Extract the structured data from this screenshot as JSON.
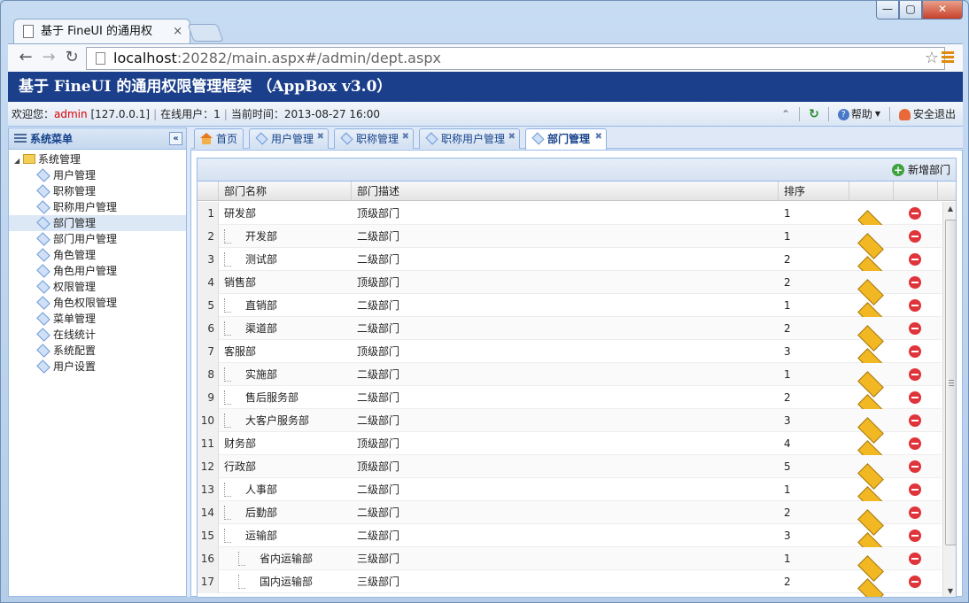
{
  "browser": {
    "tab_title": "基于 FineUI 的通用权",
    "url_host": "localhost",
    "url_rest": ":20282/main.aspx#/admin/dept.aspx",
    "window_buttons": [
      "—",
      "▢",
      "✕"
    ]
  },
  "app": {
    "title": "基于 FineUI 的通用权限管理框架 （AppBox v3.0）",
    "welcome_label": "欢迎您：",
    "user": "admin",
    "ip": "[127.0.0.1]",
    "online_label": "在线用户：",
    "online_count": "1",
    "time_label": "当前时间：",
    "time_value": "2013-08-27 16:00",
    "help": "帮助",
    "logout": "安全退出"
  },
  "sidebar": {
    "title": "系统菜单",
    "root": "系统管理",
    "items": [
      {
        "label": "用户管理"
      },
      {
        "label": "职称管理"
      },
      {
        "label": "职称用户管理"
      },
      {
        "label": "部门管理"
      },
      {
        "label": "部门用户管理"
      },
      {
        "label": "角色管理"
      },
      {
        "label": "角色用户管理"
      },
      {
        "label": "权限管理"
      },
      {
        "label": "角色权限管理"
      },
      {
        "label": "菜单管理"
      },
      {
        "label": "在线统计"
      },
      {
        "label": "系统配置"
      },
      {
        "label": "用户设置"
      }
    ]
  },
  "tabs": [
    {
      "label": "首页"
    },
    {
      "label": "用户管理"
    },
    {
      "label": "职称管理"
    },
    {
      "label": "职称用户管理"
    },
    {
      "label": "部门管理"
    }
  ],
  "grid": {
    "add_label": "新增部门",
    "columns": [
      "部门名称",
      "部门描述",
      "排序"
    ],
    "rows": [
      {
        "n": "1",
        "name": "研发部",
        "level": 0,
        "desc": "顶级部门",
        "sort": "1"
      },
      {
        "n": "2",
        "name": "开发部",
        "level": 1,
        "desc": "二级部门",
        "sort": "1"
      },
      {
        "n": "3",
        "name": "测试部",
        "level": 1,
        "desc": "二级部门",
        "sort": "2"
      },
      {
        "n": "4",
        "name": "销售部",
        "level": 0,
        "desc": "顶级部门",
        "sort": "2"
      },
      {
        "n": "5",
        "name": "直销部",
        "level": 1,
        "desc": "二级部门",
        "sort": "1"
      },
      {
        "n": "6",
        "name": "渠道部",
        "level": 1,
        "desc": "二级部门",
        "sort": "2"
      },
      {
        "n": "7",
        "name": "客服部",
        "level": 0,
        "desc": "顶级部门",
        "sort": "3"
      },
      {
        "n": "8",
        "name": "实施部",
        "level": 1,
        "desc": "二级部门",
        "sort": "1"
      },
      {
        "n": "9",
        "name": "售后服务部",
        "level": 1,
        "desc": "二级部门",
        "sort": "2"
      },
      {
        "n": "10",
        "name": "大客户服务部",
        "level": 1,
        "desc": "二级部门",
        "sort": "3"
      },
      {
        "n": "11",
        "name": "财务部",
        "level": 0,
        "desc": "顶级部门",
        "sort": "4"
      },
      {
        "n": "12",
        "name": "行政部",
        "level": 0,
        "desc": "顶级部门",
        "sort": "5"
      },
      {
        "n": "13",
        "name": "人事部",
        "level": 1,
        "desc": "二级部门",
        "sort": "1"
      },
      {
        "n": "14",
        "name": "后勤部",
        "level": 1,
        "desc": "二级部门",
        "sort": "2"
      },
      {
        "n": "15",
        "name": "运输部",
        "level": 1,
        "desc": "二级部门",
        "sort": "3"
      },
      {
        "n": "16",
        "name": "省内运输部",
        "level": 2,
        "desc": "三级部门",
        "sort": "1"
      },
      {
        "n": "17",
        "name": "国内运输部",
        "level": 2,
        "desc": "三级部门",
        "sort": "2"
      }
    ]
  }
}
